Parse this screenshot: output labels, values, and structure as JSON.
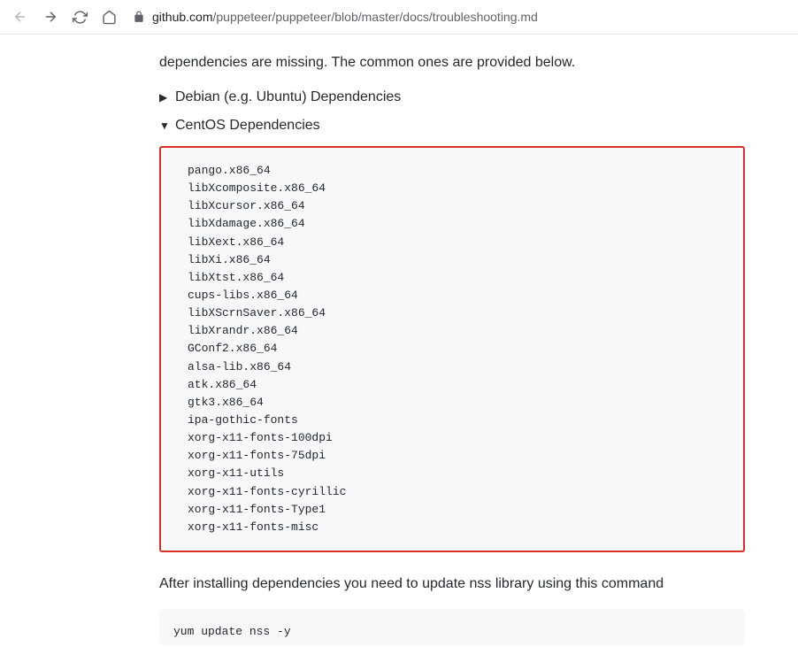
{
  "browser": {
    "url_domain": "github.com",
    "url_path": "/puppeteer/puppeteer/blob/master/docs/troubleshooting.md"
  },
  "page": {
    "intro": "dependencies are missing. The common ones are provided below.",
    "details_closed": "Debian (e.g. Ubuntu) Dependencies",
    "details_open": "CentOS Dependencies",
    "packages": [
      "pango.x86_64",
      "libXcomposite.x86_64",
      "libXcursor.x86_64",
      "libXdamage.x86_64",
      "libXext.x86_64",
      "libXi.x86_64",
      "libXtst.x86_64",
      "cups-libs.x86_64",
      "libXScrnSaver.x86_64",
      "libXrandr.x86_64",
      "GConf2.x86_64",
      "alsa-lib.x86_64",
      "atk.x86_64",
      "gtk3.x86_64",
      "ipa-gothic-fonts",
      "xorg-x11-fonts-100dpi",
      "xorg-x11-fonts-75dpi",
      "xorg-x11-utils",
      "xorg-x11-fonts-cyrillic",
      "xorg-x11-fonts-Type1",
      "xorg-x11-fonts-misc"
    ],
    "after_text": "After installing dependencies you need to update nss library using this command",
    "update_cmd": "yum update nss -y"
  }
}
